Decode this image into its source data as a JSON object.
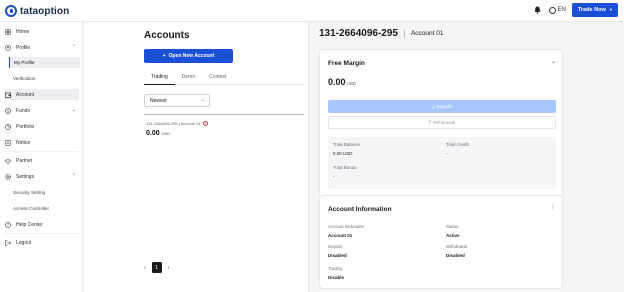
{
  "topbar": {
    "brand": "tataoption",
    "language": "EN",
    "trade_now": "Trade Now"
  },
  "sidebar": {
    "home": "Home",
    "profile": "Profile",
    "my_profile": "My Profile",
    "verification": "Verification",
    "account": "Account",
    "funds": "Funds",
    "portfolio": "Portfolio",
    "notice": "Notice",
    "partner": "Partner",
    "settings": "Settings",
    "security_setting": "Security Setting",
    "access_controller": "Access Controller",
    "help_center": "Help Center",
    "logout": "Logout"
  },
  "accounts": {
    "title": "Accounts",
    "open_button": "Open New Account",
    "tabs": [
      "Trading",
      "Demo",
      "Contest"
    ],
    "sort_selected": "Newest",
    "list": [
      {
        "line": "131-2664096-295 | Account 01",
        "amount": "0.00",
        "currency": "USD"
      }
    ],
    "page": "1"
  },
  "detail": {
    "account_number": "131-2664096-295",
    "account_name": "Account 01",
    "free_margin": {
      "title": "Free Margin",
      "amount": "0.00",
      "currency": "USD",
      "deposit": "Deposit",
      "withdrawal": "Withdrawal",
      "total_balance_label": "Total Balance",
      "total_balance_value": "0.00 USD",
      "total_credit_label": "Total Credit",
      "total_credit_value": "-",
      "total_bonus_label": "Total Bonus",
      "total_bonus_value": "-"
    },
    "info": {
      "title": "Account Information",
      "nickname_label": "Account Nickname",
      "nickname_value": "Account 01",
      "status_label": "Status",
      "status_value": "Active",
      "deposit_label": "Deposit",
      "deposit_value": "Disabled",
      "withdrawal_label": "Withdrawal",
      "withdrawal_value": "Disabled",
      "trading_label": "Trading",
      "trading_value": "Disable"
    }
  },
  "colors": {
    "primary": "#1a4fd8",
    "primary_light": "#a8c7fa",
    "alert": "#d63b3b"
  }
}
